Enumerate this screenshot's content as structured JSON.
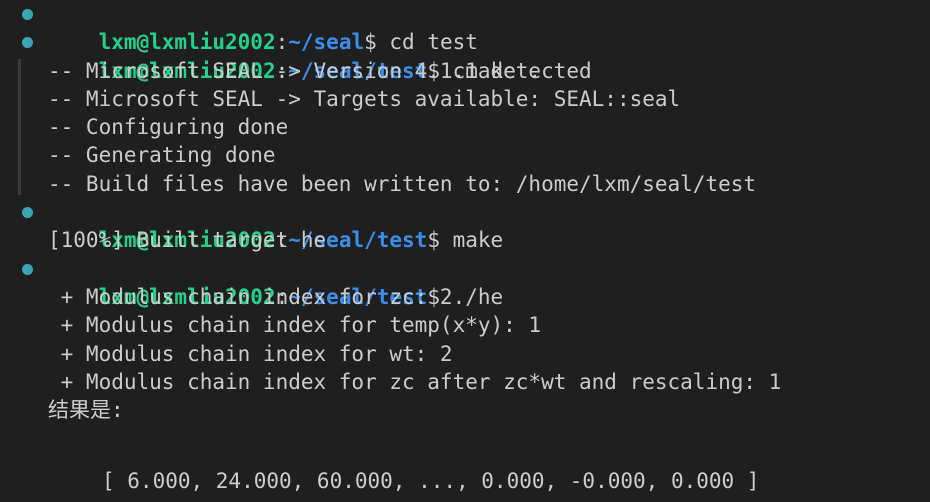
{
  "colors": {
    "background": "#1f1f1f",
    "text": "#cccccc",
    "user": "#23d18b",
    "path": "#3b8eea",
    "prompt_dot": "#3ba7b4"
  },
  "prompt": {
    "user_host": "lxm@lxmliu2002",
    "colon": ":",
    "dollar": "$"
  },
  "commands": [
    {
      "path": "~/seal",
      "cmd": " cd test"
    },
    {
      "path": "~/seal/test",
      "cmd": " cmake ."
    },
    {
      "path": "~/seal/test",
      "cmd": " make"
    },
    {
      "path": "~/seal/test",
      "cmd": " ./he"
    }
  ],
  "cmake_output": [
    "-- Microsoft SEAL -> Version 4.1.1 detected",
    "-- Microsoft SEAL -> Targets available: SEAL::seal",
    "-- Configuring done",
    "-- Generating done",
    "-- Build files have been written to: /home/lxm/seal/test"
  ],
  "make_output": [
    "[100%] Built target he"
  ],
  "he_output": [
    " + Modulus chain index for zc: 2",
    " + Modulus chain index for temp(x*y): 1",
    " + Modulus chain index for wt: 2",
    " + Modulus chain index for zc after zc*wt and rescaling: 1",
    "结果是:"
  ],
  "result_line": "[ 6.000, 24.000, 60.000, ..., 0.000, -0.000, 0.000 ]"
}
